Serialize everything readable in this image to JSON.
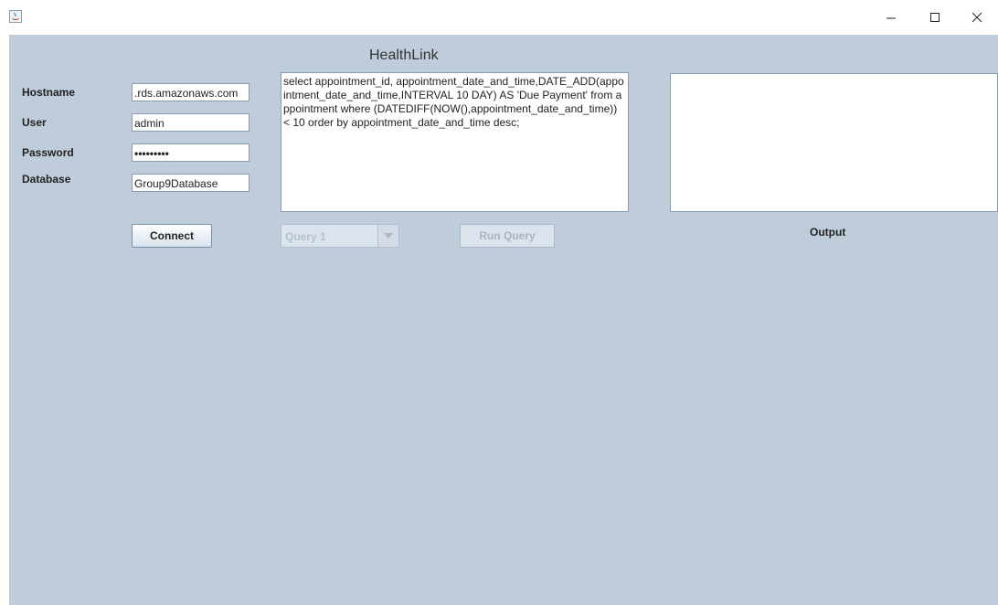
{
  "window": {
    "minimize_icon": "minimize-icon",
    "maximize_icon": "maximize-icon",
    "close_icon": "close-icon"
  },
  "app": {
    "title": "HealthLink"
  },
  "form": {
    "hostname_label": "Hostname",
    "hostname_value": ".rds.amazonaws.com",
    "user_label": "User",
    "user_value": "admin",
    "password_label": "Password",
    "password_value": "•••••••••",
    "database_label": "Database",
    "database_value": "Group9Database",
    "connect_label": "Connect"
  },
  "query": {
    "text": "select appointment_id, appointment_date_and_time,DATE_ADD(appointment_date_and_time,INTERVAL 10 DAY) AS 'Due Payment' from appointment where (DATEDIFF(NOW(),appointment_date_and_time)) < 10 order by appointment_date_and_time desc;",
    "selector_value": "Query 1",
    "run_label": "Run Query"
  },
  "output": {
    "label": "Output",
    "text": ""
  }
}
